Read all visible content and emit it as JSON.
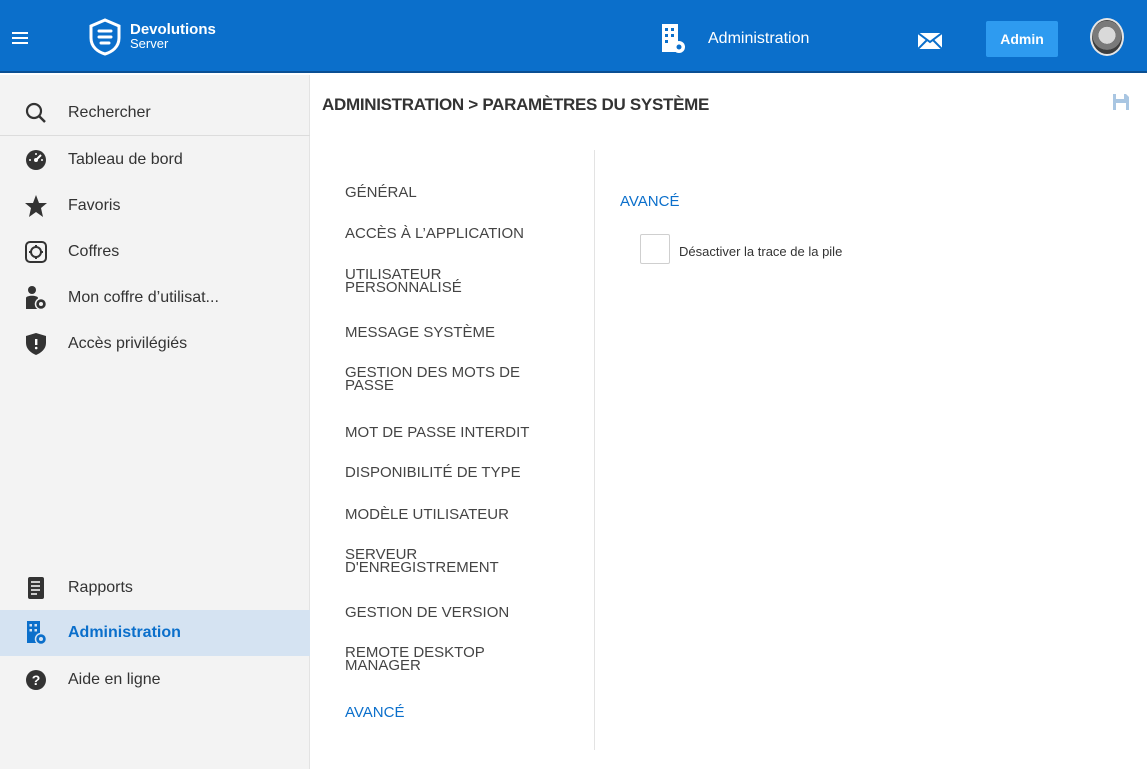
{
  "topbar": {
    "logo_line1": "Devolutions",
    "logo_line2": "Server",
    "section_label": "Administration",
    "admin_button": "Admin"
  },
  "sidebar": {
    "search": "Rechercher",
    "items": [
      {
        "label": "Tableau de bord",
        "icon": "dashboard-icon"
      },
      {
        "label": "Favoris",
        "icon": "star-icon"
      },
      {
        "label": "Coffres",
        "icon": "vault-icon"
      },
      {
        "label": "Mon coffre d’utilisat...",
        "icon": "user-vault-icon"
      },
      {
        "label": "Accès privilégiés",
        "icon": "shield-icon"
      }
    ],
    "bottom_items": [
      {
        "label": "Rapports",
        "icon": "reports-icon"
      },
      {
        "label": "Administration",
        "icon": "administration-icon",
        "active": true
      },
      {
        "label": "Aide en ligne",
        "icon": "help-icon"
      }
    ]
  },
  "breadcrumb": "ADMINISTRATION > PARAMÈTRES DU SYSTÈME",
  "menu": [
    {
      "label": "GÉNÉRAL"
    },
    {
      "label": "ACCÈS À L’APPLICATION"
    },
    {
      "label": "UTILISATEUR PERSONNALISÉ"
    },
    {
      "label": "MESSAGE SYSTÈME"
    },
    {
      "label": "GESTION DES MOTS DE PASSE"
    },
    {
      "label": "MOT DE PASSE INTERDIT"
    },
    {
      "label": "DISPONIBILITÉ DE TYPE"
    },
    {
      "label": "MODÈLE UTILISATEUR"
    },
    {
      "label": "SERVEUR D'ENREGISTREMENT"
    },
    {
      "label": "GESTION DE VERSION"
    },
    {
      "label": "REMOTE DESKTOP MANAGER"
    },
    {
      "label": "AVANCÉ",
      "active": true
    }
  ],
  "content": {
    "section_title": "AVANCÉ",
    "checkbox_label": "Désactiver la trace de la pile",
    "checkbox_checked": false
  },
  "colors": {
    "brand": "#0b6fcb",
    "admin_button": "#2e9bf0",
    "active_bg": "#d5e3f2"
  }
}
